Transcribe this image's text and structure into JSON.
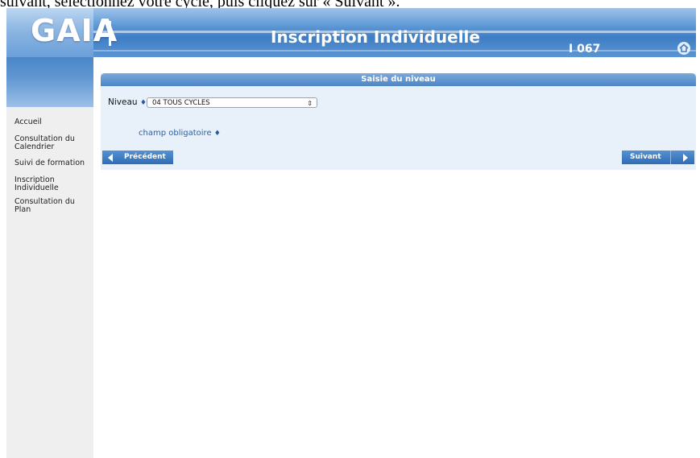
{
  "caption": "suivant, sélectionnez votre cycle, puis cliquez sur « Suivant ».",
  "header": {
    "logo": "GAIA",
    "title": "Inscription Individuelle",
    "code": "I 067"
  },
  "sidebar": {
    "items": [
      {
        "label": "Accueil"
      },
      {
        "label": "Consultation du Calendrier"
      },
      {
        "label": "Suivi de formation"
      },
      {
        "label": "Inscription Individuelle"
      },
      {
        "label": "Consultation du Plan"
      }
    ]
  },
  "form": {
    "section_title": "Saisie du niveau",
    "niveau_label": "Niveau",
    "required_marker": "♦",
    "niveau_value": "04 TOUS CYCLES",
    "required_note": "champ obligatoire",
    "prev_label": "Précédent",
    "next_label": "Suivant"
  },
  "colors": {
    "header_blue": "#3f7ec6",
    "panel_bg": "#e8f1fa",
    "button_blue": "#2e6cb6"
  },
  "icons": {
    "home": "home-icon",
    "prev": "arrow-left-icon",
    "next": "arrow-right-icon",
    "select": "updown-arrows-icon"
  }
}
